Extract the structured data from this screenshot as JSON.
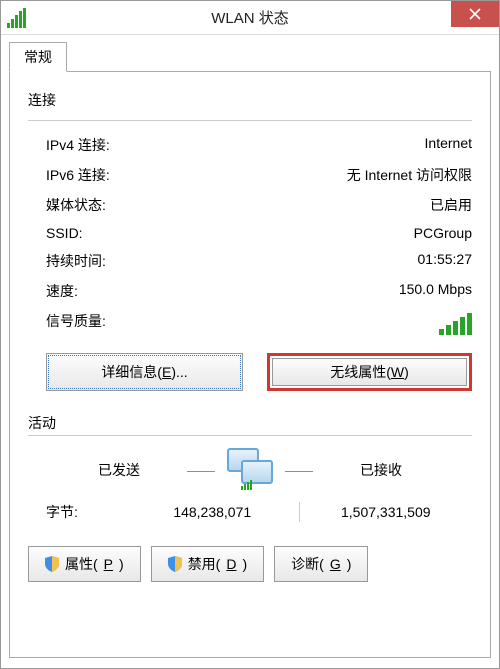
{
  "window": {
    "title": "WLAN 状态"
  },
  "tabs": {
    "general": "常规"
  },
  "connection": {
    "heading": "连接",
    "ipv4_label": "IPv4 连接:",
    "ipv4_value": "Internet",
    "ipv6_label": "IPv6 连接:",
    "ipv6_value": "无 Internet 访问权限",
    "media_label": "媒体状态:",
    "media_value": "已启用",
    "ssid_label": "SSID:",
    "ssid_value": "PCGroup",
    "duration_label": "持续时间:",
    "duration_value": "01:55:27",
    "speed_label": "速度:",
    "speed_value": "150.0 Mbps",
    "signal_label": "信号质量:"
  },
  "buttons": {
    "details_prefix": "详细信息(",
    "details_key": "E",
    "details_suffix": ")...",
    "wireless_prefix": "无线属性(",
    "wireless_key": "W",
    "wireless_suffix": ")",
    "properties_prefix": "属性(",
    "properties_key": "P",
    "properties_suffix": ")",
    "disable_prefix": "禁用(",
    "disable_key": "D",
    "disable_suffix": ")",
    "diagnose_prefix": "诊断(",
    "diagnose_key": "G",
    "diagnose_suffix": ")"
  },
  "activity": {
    "heading": "活动",
    "sent": "已发送",
    "received": "已接收",
    "bytes_label": "字节:",
    "bytes_sent": "148,238,071",
    "bytes_received": "1,507,331,509"
  }
}
